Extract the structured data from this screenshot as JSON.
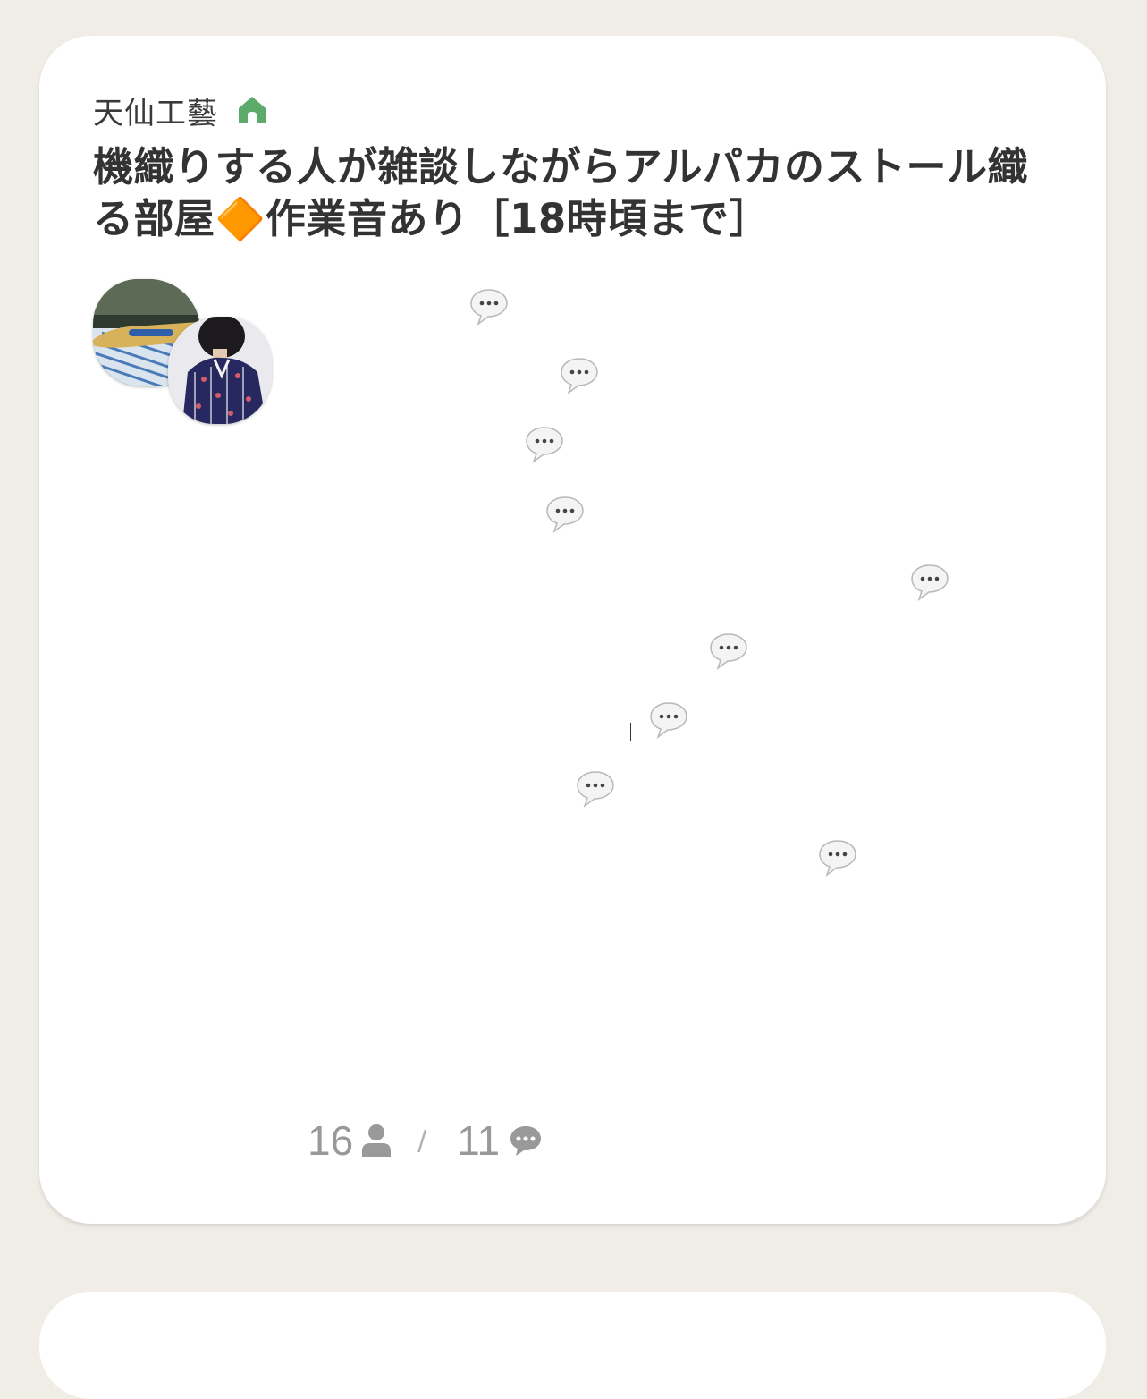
{
  "room": {
    "owner": "天仙工藝",
    "owner_icon": "home-icon",
    "title": "機織りする人が雑談しながらアルパカのストール織る部屋🔶作業音あり［18時頃まで］",
    "thumbnails": [
      "loom-shuttle-photo",
      "person-in-kimono-photo"
    ],
    "comment_bubbles": 9,
    "listeners": "16",
    "listeners_icon": "person-icon",
    "separator": "/",
    "comments": "11",
    "comments_icon": "comment-icon"
  },
  "colors": {
    "background": "#efede6",
    "card": "#ffffff",
    "title": "#333333",
    "owner": "#3a3a3a",
    "home_icon": "#5cab6b",
    "stats": "#999999"
  }
}
